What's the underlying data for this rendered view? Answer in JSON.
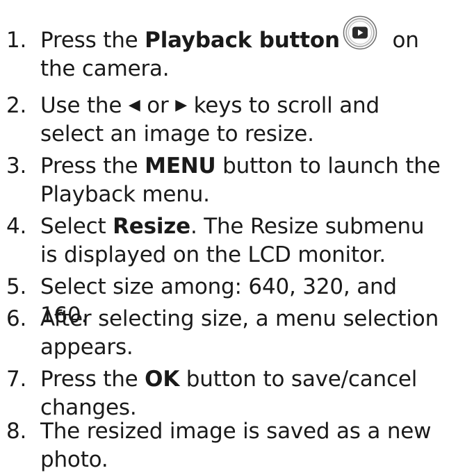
{
  "steps": [
    {
      "num": "1.",
      "pre": "Press the ",
      "bold": "Playback button",
      "post": " on the camera.",
      "icon": "playback-button-icon"
    },
    {
      "num": "2.",
      "pre": "Use the ",
      "left_key": "◀",
      "mid": " or ",
      "right_key": "▶",
      "post": " keys to scroll and select an image to resize."
    },
    {
      "num": "3.",
      "pre": "Press the ",
      "bold": "MENU",
      "post": " button to launch the Playback menu."
    },
    {
      "num": "4.",
      "pre": "Select ",
      "bold": "Resize",
      "post": ". The Resize submenu is displayed on the LCD monitor."
    },
    {
      "num": "5.",
      "text": "Select size among: 640, 320, and 160."
    },
    {
      "num": "6.",
      "text": "After selecting size, a menu selection appears."
    },
    {
      "num": "7.",
      "pre": "Press the ",
      "bold": "OK",
      "post": " button to save/cancel changes."
    },
    {
      "num": "8.",
      "text": "The resized image is saved as a new photo."
    }
  ]
}
